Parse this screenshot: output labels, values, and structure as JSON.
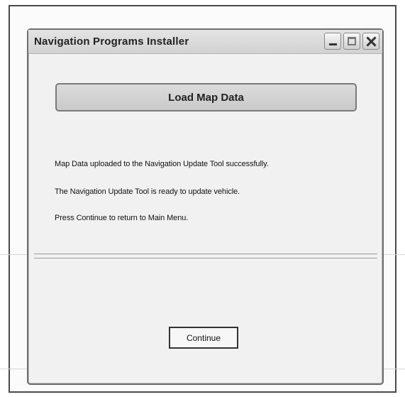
{
  "window": {
    "title": "Navigation Programs Installer"
  },
  "header_button": {
    "label": "Load Map Data"
  },
  "messages": [
    "Map Data uploaded to the Navigation Update Tool successfully.",
    "The Navigation Update Tool is ready to update vehicle.",
    "Press Continue to return to Main Menu."
  ],
  "footer": {
    "continue_label": "Continue"
  },
  "icons": {
    "minimize": "minimize-icon",
    "maximize": "maximize-icon",
    "close": "close-icon"
  }
}
